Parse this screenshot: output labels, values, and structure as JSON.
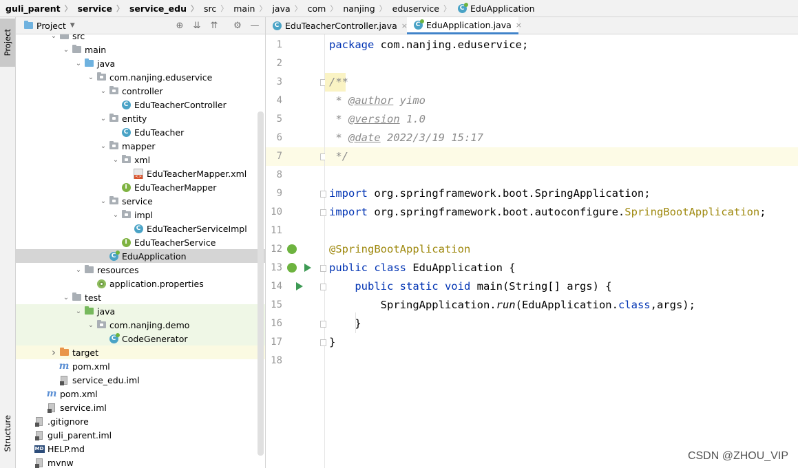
{
  "breadcrumb": [
    {
      "label": "guli_parent",
      "bold": true
    },
    {
      "label": "service",
      "bold": true
    },
    {
      "label": "service_edu",
      "bold": true
    },
    {
      "label": "src",
      "bold": false
    },
    {
      "label": "main",
      "bold": false
    },
    {
      "label": "java",
      "bold": false
    },
    {
      "label": "com",
      "bold": false
    },
    {
      "label": "nanjing",
      "bold": false
    },
    {
      "label": "eduservice",
      "bold": false
    },
    {
      "label": "EduApplication",
      "bold": false
    }
  ],
  "left_strip": {
    "project": "Project",
    "structure": "Structure"
  },
  "project_panel": {
    "title": "Project"
  },
  "tree": [
    {
      "label": "src",
      "depth": 4,
      "arrow": "down",
      "icon": "folder"
    },
    {
      "label": "main",
      "depth": 5,
      "arrow": "down",
      "icon": "folder"
    },
    {
      "label": "java",
      "depth": 6,
      "arrow": "down",
      "icon": "folder-blue"
    },
    {
      "label": "com.nanjing.eduservice",
      "depth": 7,
      "arrow": "down",
      "icon": "package"
    },
    {
      "label": "controller",
      "depth": 8,
      "arrow": "down",
      "icon": "package"
    },
    {
      "label": "EduTeacherController",
      "depth": 9,
      "arrow": "",
      "icon": "class"
    },
    {
      "label": "entity",
      "depth": 8,
      "arrow": "down",
      "icon": "package"
    },
    {
      "label": "EduTeacher",
      "depth": 9,
      "arrow": "",
      "icon": "class"
    },
    {
      "label": "mapper",
      "depth": 8,
      "arrow": "down",
      "icon": "package"
    },
    {
      "label": "xml",
      "depth": 9,
      "arrow": "down",
      "icon": "package"
    },
    {
      "label": "EduTeacherMapper.xml",
      "depth": 10,
      "arrow": "",
      "icon": "xml"
    },
    {
      "label": "EduTeacherMapper",
      "depth": 9,
      "arrow": "",
      "icon": "interface"
    },
    {
      "label": "service",
      "depth": 8,
      "arrow": "down",
      "icon": "package"
    },
    {
      "label": "impl",
      "depth": 9,
      "arrow": "down",
      "icon": "package"
    },
    {
      "label": "EduTeacherServiceImpl",
      "depth": 10,
      "arrow": "",
      "icon": "class"
    },
    {
      "label": "EduTeacherService",
      "depth": 9,
      "arrow": "",
      "icon": "interface"
    },
    {
      "label": "EduApplication",
      "depth": 8,
      "arrow": "",
      "icon": "spring-class",
      "selected": true
    },
    {
      "label": "resources",
      "depth": 6,
      "arrow": "down",
      "icon": "folder-res"
    },
    {
      "label": "application.properties",
      "depth": 7,
      "arrow": "",
      "icon": "properties"
    },
    {
      "label": "test",
      "depth": 5,
      "arrow": "down",
      "icon": "folder"
    },
    {
      "label": "java",
      "depth": 6,
      "arrow": "down",
      "icon": "folder-green",
      "test": true
    },
    {
      "label": "com.nanjing.demo",
      "depth": 7,
      "arrow": "down",
      "icon": "package",
      "test": true
    },
    {
      "label": "CodeGenerator",
      "depth": 8,
      "arrow": "",
      "icon": "spring-class",
      "test": true
    },
    {
      "label": "target",
      "depth": 4,
      "arrow": "right",
      "icon": "folder-orange",
      "excluded": true
    },
    {
      "label": "pom.xml",
      "depth": 4,
      "arrow": "",
      "icon": "maven"
    },
    {
      "label": "service_edu.iml",
      "depth": 4,
      "arrow": "",
      "icon": "file"
    },
    {
      "label": "pom.xml",
      "depth": 3,
      "arrow": "",
      "icon": "maven"
    },
    {
      "label": "service.iml",
      "depth": 3,
      "arrow": "",
      "icon": "file"
    },
    {
      "label": ".gitignore",
      "depth": 2,
      "arrow": "",
      "icon": "file"
    },
    {
      "label": "guli_parent.iml",
      "depth": 2,
      "arrow": "",
      "icon": "file"
    },
    {
      "label": "HELP.md",
      "depth": 2,
      "arrow": "",
      "icon": "md"
    },
    {
      "label": "mvnw",
      "depth": 2,
      "arrow": "",
      "icon": "file"
    }
  ],
  "tabs": [
    {
      "label": "EduTeacherController.java",
      "active": false
    },
    {
      "label": "EduApplication.java",
      "active": true
    }
  ],
  "code_lines": [
    [
      {
        "t": "package ",
        "c": "kw"
      },
      {
        "t": "com.nanjing.eduservice;",
        "c": ""
      }
    ],
    [],
    [
      {
        "t": "/**",
        "c": "cm"
      }
    ],
    [
      {
        "t": " * ",
        "c": "cm"
      },
      {
        "t": "@author",
        "c": "tag"
      },
      {
        "t": " yimo",
        "c": "cm"
      }
    ],
    [
      {
        "t": " * ",
        "c": "cm"
      },
      {
        "t": "@version",
        "c": "tag"
      },
      {
        "t": " 1.0",
        "c": "cm"
      }
    ],
    [
      {
        "t": " * ",
        "c": "cm"
      },
      {
        "t": "@date",
        "c": "tag"
      },
      {
        "t": " 2022/3/19 15:17",
        "c": "cm"
      }
    ],
    [
      {
        "t": " */",
        "c": "cm"
      }
    ],
    [],
    [
      {
        "t": "import ",
        "c": "kw"
      },
      {
        "t": "org.springframework.boot.SpringApplication;",
        "c": ""
      }
    ],
    [
      {
        "t": "import ",
        "c": "kw"
      },
      {
        "t": "org.springframework.boot.autoconfigure.",
        "c": ""
      },
      {
        "t": "SpringBootApplication",
        "c": "ann"
      },
      {
        "t": ";",
        "c": ""
      }
    ],
    [],
    [
      {
        "t": "@SpringBootApplication",
        "c": "ann"
      }
    ],
    [
      {
        "t": "public class ",
        "c": "kw"
      },
      {
        "t": "EduApplication {",
        "c": ""
      }
    ],
    [
      {
        "t": "    public static void ",
        "c": "kw"
      },
      {
        "t": "main(String[] args) {",
        "c": ""
      }
    ],
    [
      {
        "t": "        SpringApplication.",
        "c": ""
      },
      {
        "t": "run",
        "c": "it"
      },
      {
        "t": "(EduApplication.",
        "c": ""
      },
      {
        "t": "class",
        "c": "kw"
      },
      {
        "t": ",args);",
        "c": ""
      }
    ],
    [
      {
        "t": "    }",
        "c": ""
      }
    ],
    [
      {
        "t": "}",
        "c": ""
      }
    ],
    []
  ],
  "line_numbers": [
    "1",
    "2",
    "3",
    "4",
    "5",
    "6",
    "7",
    "8",
    "9",
    "10",
    "11",
    "12",
    "13",
    "14",
    "15",
    "16",
    "17",
    "18"
  ],
  "watermark": "CSDN @ZHOU_VIP"
}
